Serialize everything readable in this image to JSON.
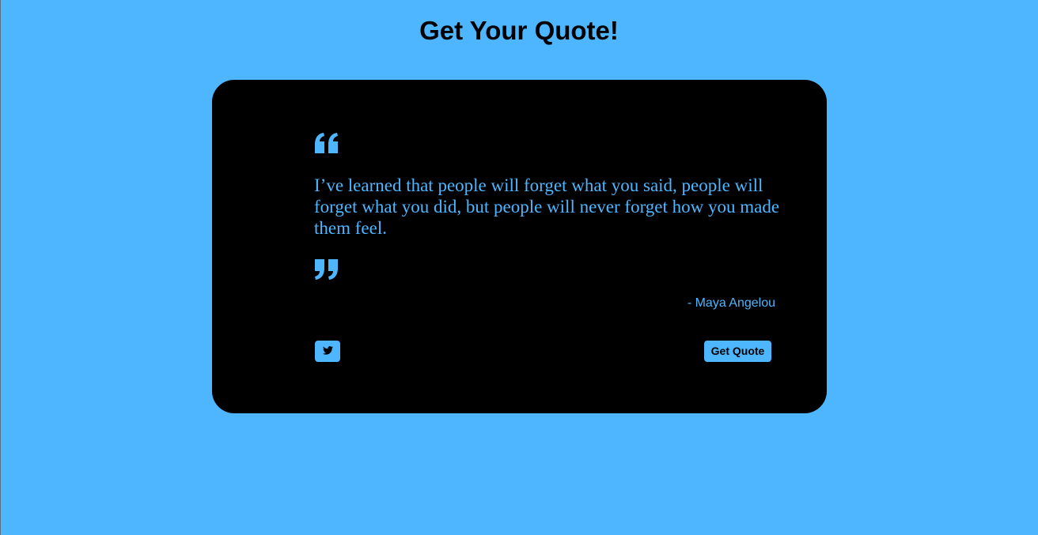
{
  "header": {
    "title": "Get Your Quote!"
  },
  "quote": {
    "text": "I’ve learned that people will forget what you said, people will forget what you did, but people will never forget how you made them feel.",
    "author": "- Maya Angelou"
  },
  "actions": {
    "tweet_icon": "twitter-icon",
    "new_quote_label": "Get Quote"
  },
  "colors": {
    "background": "#4db6ff",
    "card": "#000000",
    "accent": "#4db6ff"
  }
}
